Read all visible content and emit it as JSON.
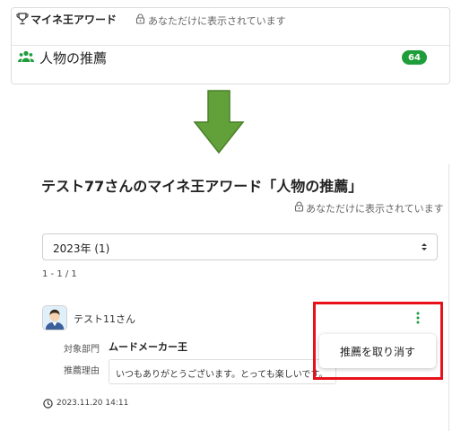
{
  "summary_card": {
    "award_title": "マイネ王アワード",
    "private_note": "あなただけに表示されています",
    "category_label": "人物の推薦",
    "count_badge": "64"
  },
  "detail": {
    "title": "テスト77さんのマイネ王アワード「人物の推薦」",
    "private_note": "あなただけに表示されています",
    "year_select": {
      "selected": "2023年 (1)"
    },
    "result_range": "1 - 1 / 1",
    "recommendation": {
      "user_name": "テスト11さん",
      "department_label": "対象部門",
      "department_value": "ムードメーカー王",
      "reason_label": "推薦理由",
      "reason_text": "いつもありがとうございます。とっても楽しいです。",
      "timestamp": "2023.11.20 14:11",
      "menu_item": "推薦を取り消す"
    }
  },
  "colors": {
    "accent_green": "#1e9e3b",
    "arrow_green": "#62a03a",
    "highlight_red": "#e8111a"
  },
  "icons": [
    "trophy-icon",
    "lock-icon",
    "people-icon",
    "arrow-down-icon",
    "select-caret-icon",
    "avatar-icon",
    "kebab-icon",
    "clock-icon"
  ]
}
